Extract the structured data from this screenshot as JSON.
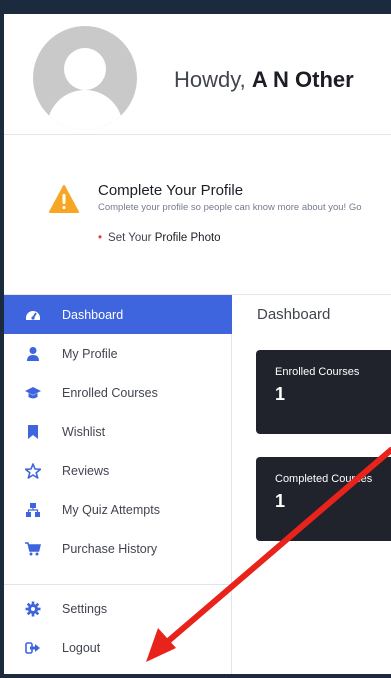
{
  "header": {
    "greeting": "Howdy,",
    "user_name": "A N Other"
  },
  "notice": {
    "icon": "warning-triangle-icon",
    "title": "Complete Your Profile",
    "subtitle": "Complete your profile so people can know more about you! Go",
    "item_prefix": "Set Your",
    "item_link": "Profile Photo"
  },
  "sidebar": {
    "items": [
      {
        "label": "Dashboard",
        "icon": "dashboard-icon",
        "active": true
      },
      {
        "label": "My Profile",
        "icon": "user-icon"
      },
      {
        "label": "Enrolled Courses",
        "icon": "graduation-cap-icon"
      },
      {
        "label": "Wishlist",
        "icon": "bookmark-icon"
      },
      {
        "label": "Reviews",
        "icon": "star-icon"
      },
      {
        "label": "My Quiz Attempts",
        "icon": "quiz-icon"
      },
      {
        "label": "Purchase History",
        "icon": "cart-icon"
      },
      {
        "label": "Settings",
        "icon": "gear-icon"
      },
      {
        "label": "Logout",
        "icon": "logout-icon"
      }
    ]
  },
  "main": {
    "title": "Dashboard",
    "cards": [
      {
        "label": "Enrolled Courses",
        "value": "1"
      },
      {
        "label": "Completed Courses",
        "value": "1"
      }
    ]
  },
  "colors": {
    "accent": "#3e64de",
    "icon": "#3e64de",
    "card_bg": "#20232b",
    "frame": "#1c2a3d",
    "warning": "#f5a623",
    "annotation_arrow": "#e8231c"
  }
}
